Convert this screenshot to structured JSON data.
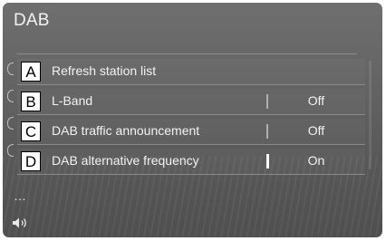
{
  "screen": {
    "title": "DAB"
  },
  "items": [
    {
      "letter": "A",
      "label": "Refresh station list",
      "value": ""
    },
    {
      "letter": "B",
      "label": "L-Band",
      "value": "Off"
    },
    {
      "letter": "C",
      "label": "DAB traffic announcement",
      "value": "Off"
    },
    {
      "letter": "D",
      "label": "DAB alternative frequency",
      "value": "On"
    }
  ],
  "sidebar": {
    "more": "…",
    "icons": [
      "menu-icon",
      "more-icon",
      "volume-icon"
    ]
  }
}
